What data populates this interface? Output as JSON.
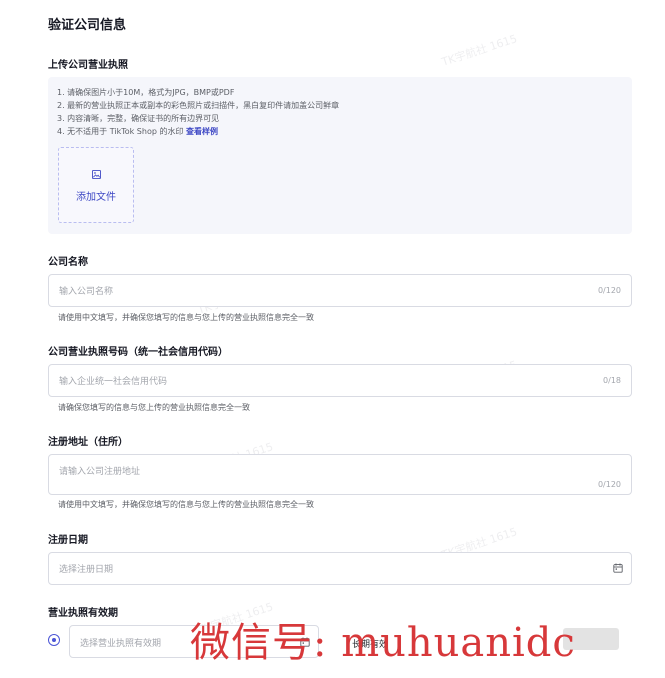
{
  "page_title": "验证公司信息",
  "license_upload": {
    "label": "上传公司营业执照",
    "tips": [
      "1. 请确保图片小于10M，格式为JPG，BMP或PDF",
      "2. 最新的营业执照正本或副本的彩色照片或扫描件，黑白复印件请加盖公司鲜章",
      "3. 内容清晰，完整，确保证书的所有边界可见",
      "4. 无不适用于 TikTok Shop 的水印 "
    ],
    "example_link": "查看样例",
    "add_file_label": "添加文件"
  },
  "company_name": {
    "label": "公司名称",
    "placeholder": "输入公司名称",
    "counter": "0/120",
    "hint": "请使用中文填写，并确保您填写的信息与您上传的营业执照信息完全一致"
  },
  "license_number": {
    "label": "公司营业执照号码（统一社会信用代码）",
    "placeholder": "输入企业统一社会信用代码",
    "counter": "0/18",
    "hint": "请确保您填写的信息与您上传的营业执照信息完全一致"
  },
  "registered_address": {
    "label": "注册地址（住所）",
    "placeholder": "请输入公司注册地址",
    "counter": "0/120",
    "hint": "请使用中文填写，并确保您填写的信息与您上传的营业执照信息完全一致"
  },
  "registration_date": {
    "label": "注册日期",
    "placeholder": "选择注册日期"
  },
  "license_validity": {
    "label": "营业执照有效期",
    "placeholder": "选择营业执照有效期",
    "long_term_label": "长期有效"
  },
  "watermark_text": "TK宇航社 1615",
  "overlay_text": "微信号: muhuanidc",
  "colors": {
    "accent": "#4b55d6",
    "link": "#3f49c5",
    "overlay_red": "#d7383a"
  }
}
